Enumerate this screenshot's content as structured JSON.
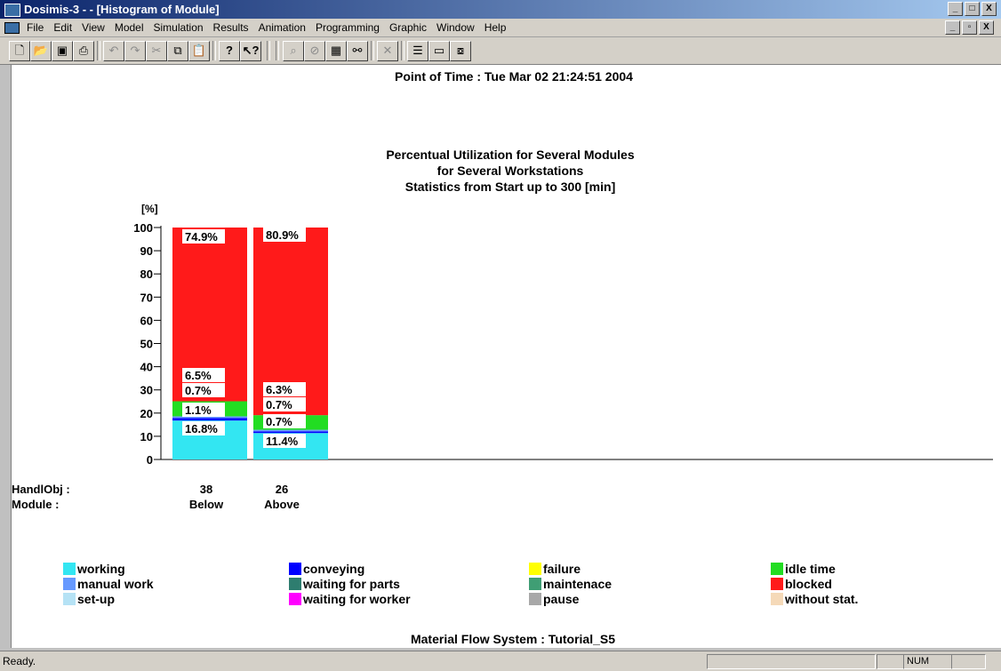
{
  "window": {
    "title": "Dosimis-3 - - [Histogram of Module]",
    "minimize_glyph": "_",
    "maximize_glyph": "□",
    "close_glyph": "X",
    "restore_glyph": "▫"
  },
  "menu": [
    "File",
    "Edit",
    "View",
    "Model",
    "Simulation",
    "Results",
    "Animation",
    "Programming",
    "Graphic",
    "Window",
    "Help"
  ],
  "toolbar": {
    "icons": [
      "new-file-icon",
      "open-file-icon",
      "save-icon",
      "print-icon",
      "undo-icon",
      "redo-icon",
      "cut-icon",
      "copy-icon",
      "paste-icon",
      "help-icon",
      "context-help-icon",
      "zoom-icon",
      "no-icon",
      "table-icon",
      "binoculars-icon",
      "delete-icon",
      "list-icon",
      "window-icon",
      "dialog-icon"
    ]
  },
  "header": {
    "point_of_time": "Point of Time : Tue Mar 02 21:24:51 2004",
    "title_lines": [
      "Percentual Utilization for Several Modules",
      "for Several Workstations",
      "Statistics from Start up to 300 [min]"
    ],
    "footer": "Material Flow System : Tutorial_S5"
  },
  "chart_data": {
    "type": "bar",
    "stacked": true,
    "title": "Percentual Utilization for Several Modules for Several Workstations",
    "subtitle": "Statistics from Start up to 300 [min]",
    "ylabel": "[%]",
    "ylim": [
      0,
      100
    ],
    "yticks": [
      0,
      10,
      20,
      30,
      40,
      50,
      60,
      70,
      80,
      90,
      100
    ],
    "row_labels": [
      "HandlObj :",
      "Module :"
    ],
    "categories": [
      {
        "handlobj": "38",
        "module": "Below"
      },
      {
        "handlobj": "26",
        "module": "Above"
      }
    ],
    "series": [
      {
        "name": "working",
        "color": "#33e6f2",
        "values": [
          16.8,
          11.4
        ],
        "labels": [
          "16.8%",
          "11.4%"
        ]
      },
      {
        "name": "conveying",
        "color": "#0000ff",
        "values": [
          1.1,
          0.7
        ],
        "labels": [
          "1.1%",
          "0.7%"
        ]
      },
      {
        "name": "failure",
        "color": "#ffff00",
        "values": [
          0,
          0
        ],
        "labels": [
          "",
          ""
        ]
      },
      {
        "name": "manual work",
        "color": "#6699ff",
        "values": [
          0.7,
          0.7
        ],
        "labels": [
          "0.7%",
          "0.7%"
        ]
      },
      {
        "name": "idle time",
        "color": "#22dd22",
        "values": [
          6.5,
          6.3
        ],
        "labels": [
          "6.5%",
          "6.3%"
        ]
      },
      {
        "name": "blocked",
        "color": "#ff1a1a",
        "values": [
          74.9,
          80.9
        ],
        "labels": [
          "74.9%",
          "80.9%"
        ]
      }
    ],
    "legend": [
      {
        "name": "working",
        "color": "#33e6f2"
      },
      {
        "name": "conveying",
        "color": "#0000ff"
      },
      {
        "name": "failure",
        "color": "#ffff00"
      },
      {
        "name": "idle time",
        "color": "#22dd22"
      },
      {
        "name": "manual work",
        "color": "#6699ff"
      },
      {
        "name": "waiting for parts",
        "color": "#2e7d6f"
      },
      {
        "name": "maintenace",
        "color": "#3f9e74"
      },
      {
        "name": "blocked",
        "color": "#ff1a1a"
      },
      {
        "name": "set-up",
        "color": "#b5e2f5"
      },
      {
        "name": "waiting for worker",
        "color": "#ff00ff"
      },
      {
        "name": "pause",
        "color": "#a8a8a8"
      },
      {
        "name": "without stat.",
        "color": "#f5d9b8"
      }
    ],
    "legend_position": "bottom"
  },
  "status": {
    "text": "Ready.",
    "num": "NUM"
  }
}
